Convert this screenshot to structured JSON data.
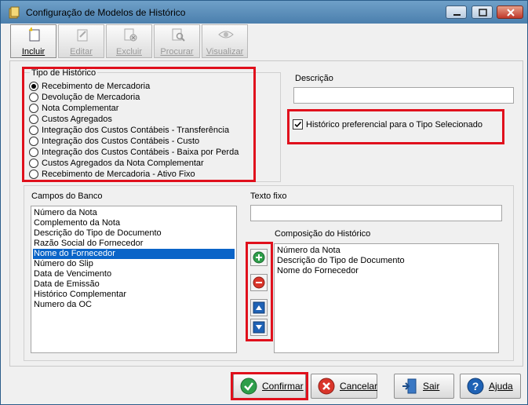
{
  "window": {
    "title": "Configuração de Modelos de Histórico"
  },
  "toolbar": {
    "items": [
      {
        "label": "Incluir",
        "enabled": true
      },
      {
        "label": "Editar",
        "enabled": false
      },
      {
        "label": "Excluir",
        "enabled": false
      },
      {
        "label": "Procurar",
        "enabled": false
      },
      {
        "label": "Visualizar",
        "enabled": false
      }
    ]
  },
  "tipo_historico": {
    "title": "Tipo de Histórico",
    "selected_index": 0,
    "options": [
      "Recebimento de Mercadoria",
      "Devolução de Mercadoria",
      "Nota Complementar",
      "Custos Agregados",
      "Integração dos Custos Contábeis - Transferência",
      "Integração dos Custos Contábeis - Custo",
      "Integração dos Custos Contábeis - Baixa por Perda",
      "Custos Agregados da Nota Complementar",
      "Recebimento de Mercadoria - Ativo Fixo"
    ]
  },
  "descricao": {
    "label": "Descrição",
    "value": ""
  },
  "preferencial": {
    "label": "Histórico preferencial para o Tipo Selecionado",
    "checked": true
  },
  "campos_banco": {
    "label": "Campos do Banco",
    "selected_index": 4,
    "items": [
      "Número da Nota",
      "Complemento da Nota",
      "Descrição do Tipo de Documento",
      "Razão Social do Fornecedor",
      "Nome do Fornecedor",
      "Número do Slip",
      "Data de Vencimento",
      "Data de Emissão",
      "Histórico Complementar",
      "Numero da OC"
    ]
  },
  "texto_fixo": {
    "label": "Texto fixo",
    "value": ""
  },
  "composicao": {
    "label": "Composição do Histórico",
    "items": [
      "Número da Nota",
      "Descrição do Tipo de Documento",
      "Nome do Fornecedor"
    ]
  },
  "footer": {
    "confirmar": "Confirmar",
    "cancelar": "Cancelar",
    "sair": "Sair",
    "ajuda": "Ajuda"
  },
  "colors": {
    "highlight_red": "#e0101c",
    "selection_blue": "#0a64c8",
    "add_green": "#2e9e4a",
    "remove_red": "#d9352a",
    "arrow_blue": "#1f62b5"
  }
}
